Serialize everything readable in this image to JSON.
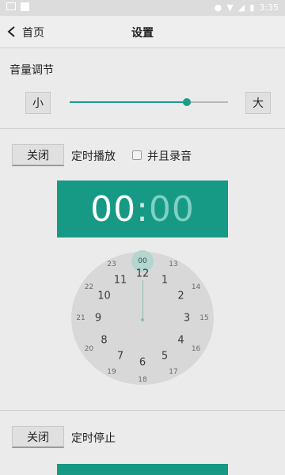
{
  "status_bar": {
    "time": "3:35"
  },
  "header": {
    "back_label": "首页",
    "title": "设置"
  },
  "volume": {
    "section_title": "音量调节",
    "min_label": "小",
    "max_label": "大",
    "level": 0.74
  },
  "timed_play": {
    "toggle_label": "关闭",
    "label": "定时播放",
    "record_label": "并且录音",
    "record_checked": false,
    "hour": "00",
    "separator": ":",
    "minute": "00"
  },
  "clock": {
    "selected": "00",
    "inner": [
      "12",
      "1",
      "2",
      "3",
      "4",
      "5",
      "6",
      "7",
      "8",
      "9",
      "10",
      "11"
    ],
    "outer": [
      "00",
      "13",
      "14",
      "15",
      "16",
      "17",
      "18",
      "19",
      "20",
      "21",
      "22",
      "23"
    ]
  },
  "timed_stop": {
    "toggle_label": "关闭",
    "label": "定时停止"
  },
  "colors": {
    "accent": "#169a86",
    "background": "#ebebeb"
  }
}
